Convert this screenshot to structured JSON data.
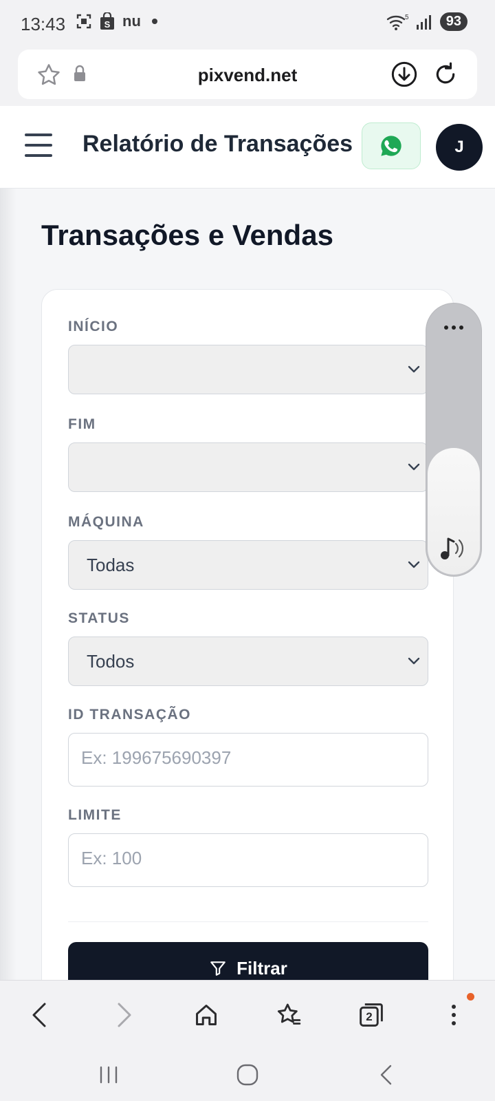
{
  "status_bar": {
    "time": "13:43",
    "carrier_label": "nu",
    "battery": "93",
    "signal_icon": "signal-icon",
    "wifi_icon": "wifi-icon"
  },
  "browser": {
    "url": "pixvend.net"
  },
  "header": {
    "title": "Relatório de Transações",
    "avatar_initial": "J"
  },
  "page": {
    "title": "Transações e Vendas"
  },
  "filters": {
    "inicio": {
      "label": "INÍCIO",
      "value": ""
    },
    "fim": {
      "label": "FIM",
      "value": ""
    },
    "maquina": {
      "label": "MÁQUINA",
      "value": "Todas"
    },
    "status": {
      "label": "STATUS",
      "value": "Todos"
    },
    "id_transacao": {
      "label": "ID TRANSAÇÃO",
      "placeholder": "Ex: 199675690397"
    },
    "limite": {
      "label": "LIMITE",
      "placeholder": "Ex: 100"
    },
    "filter_button": "Filtrar"
  },
  "bottom_toolbar": {
    "tab_count": "2"
  },
  "colors": {
    "primary_dark": "#111827",
    "whatsapp_green": "#1fa855",
    "notification_orange": "#e8622a"
  }
}
